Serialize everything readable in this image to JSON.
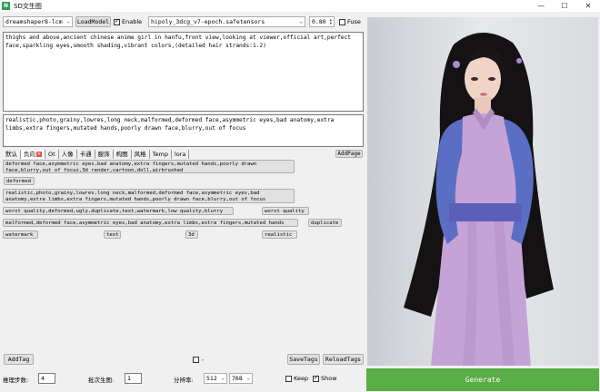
{
  "window": {
    "title": "SD文生图",
    "icon": "sd-app-icon"
  },
  "toolbar": {
    "model": "dreamshaper8-lcm",
    "load_model": "LoadModel",
    "enable_label": "Enable",
    "enable_checked": true,
    "lora": "hipoly_3dcg_v7-epoch.safetensors",
    "weight": "0.80",
    "fuse_label": "Fuse",
    "fuse_checked": false
  },
  "positive_prompt": "thighs and above,ancient chinese anime girl in hanfu,front view,looking at viewer,official art,perfect face,sparkling eyes,smooth shading,vibrant colors,(detailed hair strands:1.2)",
  "negative_prompt": "realistic,photo,grainy,lowres,long neck,malformed,deformed face,asymmetric eyes,bad anatomy,extra limbs,extra fingers,mutated hands,poorly drawn face,blurry,out of focus",
  "tabs": [
    "默认",
    "负向",
    "Ot",
    "人像",
    "卡通",
    "服饰",
    "构图",
    "风格",
    "Temp",
    "lora"
  ],
  "add_page": "AddPage",
  "tags": {
    "t1": "deformed face,asymmetric eyes,bad anatomy,extra fingers,mutated hands,poorly drawn face,blurry,out of focus,3d render,cartoon,doll,airbrushed",
    "t2": "deformed",
    "t3": "realistic,photo,grainy,lowres,long neck,malformed,deformed face,asymmetric eyes,bad anatomy,extra limbs,extra fingers,mutated hands,poorly drawn face,blurry,out of focus",
    "t4": "worst quality,deformed,ugly,duplicate,text,watermark,low quality,blurry",
    "t5": "worst quality",
    "t6": "malformed,deformed face,asymmetric eyes,bad anatomy,extra limbs,extra fingers,mutated hands",
    "t7": "duplicate",
    "t8": "watermark",
    "t9": "text",
    "t10": "3d",
    "t11": "realistic"
  },
  "footer": {
    "add_tag": "AddTag",
    "comma": ",",
    "save_tags": "SaveTags",
    "reload_tags": "ReloadTags"
  },
  "bottom": {
    "steps_label": "推理步数:",
    "steps": "4",
    "batch_label": "批次生图:",
    "batch": "1",
    "res_label": "分辨率:",
    "width": "512",
    "height": "768",
    "keep_label": "Keep",
    "show_label": "Show",
    "show_checked": true
  },
  "generate": "Generate",
  "colors": {
    "generate_bg": "#5aac44"
  }
}
